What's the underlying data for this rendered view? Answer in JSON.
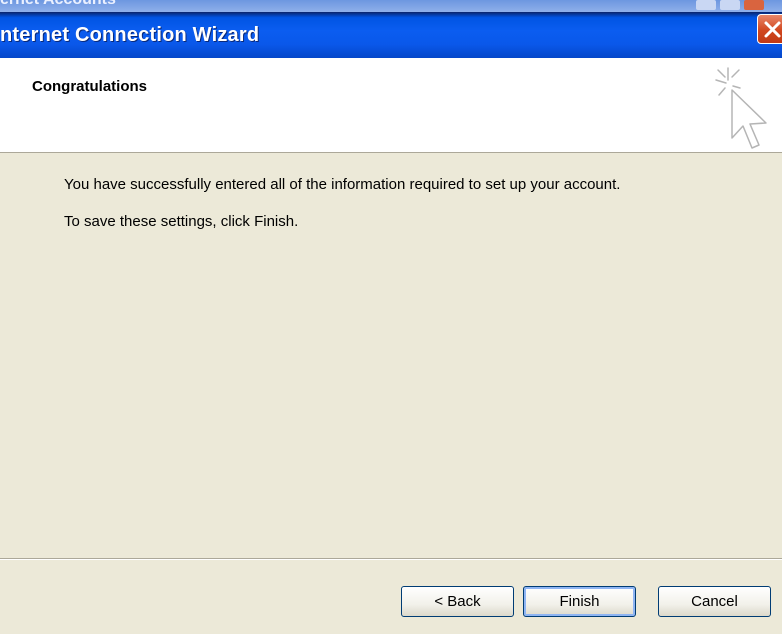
{
  "background_window": {
    "title": "ernet Accounts"
  },
  "dialog": {
    "title": "nternet Connection Wizard",
    "header_title": "Congratulations",
    "message_line1": "You have successfully entered all of the information required to set up your account.",
    "message_line2": "To save these settings, click Finish."
  },
  "buttons": {
    "back": "< Back",
    "finish": "Finish",
    "cancel": "Cancel"
  },
  "icons": {
    "close": "close-icon",
    "wizard": "cursor-sparkle-icon"
  },
  "colors": {
    "titlebar": "#0054e3",
    "close": "#d1471f",
    "dialog_bg": "#ece9d8",
    "header_bg": "#ffffff"
  }
}
